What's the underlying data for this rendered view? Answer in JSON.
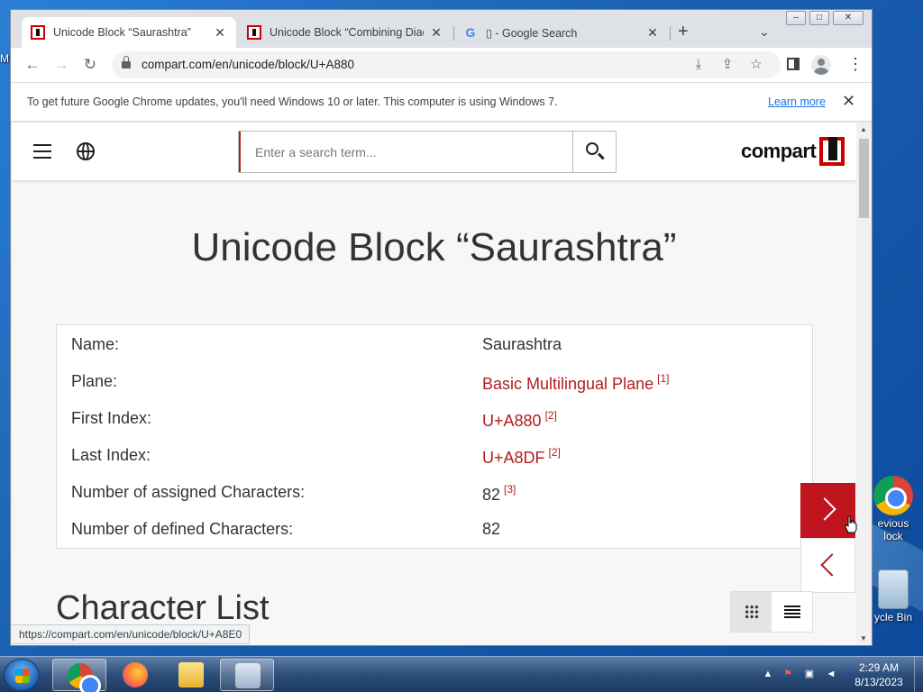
{
  "desktop": {
    "left_label": "M",
    "icons": [
      {
        "label": "evious\nlock",
        "line1": "evious",
        "line2": "lock"
      },
      {
        "label": "ycle Bin"
      }
    ]
  },
  "browser": {
    "tabs": [
      {
        "title": "Unicode Block “Saurashtra”",
        "active": true,
        "icon": "compart-favicon"
      },
      {
        "title": "Unicode Block “Combining Diacr",
        "active": false,
        "icon": "compart-favicon"
      },
      {
        "title": " - Google Search",
        "prefix_glyph": "▯",
        "active": false,
        "icon": "google-favicon"
      }
    ],
    "new_tab_glyph": "+",
    "tab_search_glyph": "⌄",
    "window_controls": [
      "–",
      "□",
      "✕"
    ],
    "url": "compart.com/en/unicode/block/U+A880",
    "infobar": {
      "message": "To get future Google Chrome updates, you'll need Windows 10 or later. This computer is using Windows 7.",
      "link": "Learn more"
    },
    "status_url": "https://compart.com/en/unicode/block/U+A8E0"
  },
  "site": {
    "search_placeholder": "Enter a search term...",
    "logo_text": "compart",
    "page_title": "Unicode Block “Saurashtra”",
    "info_rows": [
      {
        "key": "Name:",
        "value": "Saurashtra",
        "link": false,
        "note": ""
      },
      {
        "key": "Plane:",
        "value": "Basic Multilingual Plane",
        "link": true,
        "note": "[1]"
      },
      {
        "key": "First Index:",
        "value": "U+A880",
        "link": true,
        "note": "[2]"
      },
      {
        "key": "Last Index:",
        "value": "U+A8DF",
        "link": true,
        "note": "[2]"
      },
      {
        "key": "Number of assigned Characters:",
        "value": "82",
        "link": false,
        "note": "[3]"
      },
      {
        "key": "Number of defined Characters:",
        "value": "82",
        "link": false,
        "note": ""
      }
    ],
    "section_title": "Character List",
    "accent_color": "#c0141e"
  },
  "taskbar": {
    "apps": [
      "chrome",
      "firefox",
      "file-explorer",
      "lambda-app"
    ],
    "time": "2:29 AM",
    "date": "8/13/2023"
  }
}
